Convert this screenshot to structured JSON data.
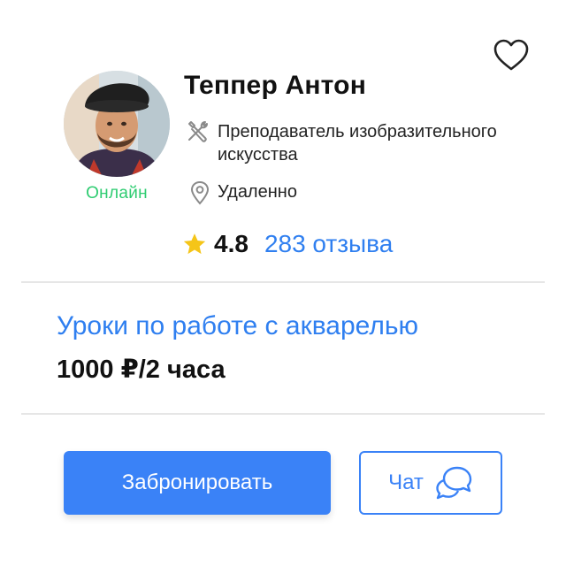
{
  "tutor": {
    "name": "Теппер Антон",
    "status": "Онлайн",
    "role": "Преподаватель  изобразительного искусства",
    "location": "Удаленно",
    "rating": "4.8",
    "reviews": "283 отзыва"
  },
  "offer": {
    "title": "Уроки по работе с акварелью",
    "price": "1000 ₽/2 часа"
  },
  "actions": {
    "book_label": "Забронировать",
    "chat_label": "Чат"
  },
  "icons": {
    "favorite": "heart-outline-icon",
    "role": "tools-icon",
    "location": "map-pin-icon",
    "rating": "star-icon",
    "chat": "chat-bubbles-icon"
  },
  "colors": {
    "accent": "#3a82f7",
    "link": "#2f7ff0",
    "online": "#2ecc71",
    "star": "#f5c518",
    "divider": "#e6e6e6"
  }
}
